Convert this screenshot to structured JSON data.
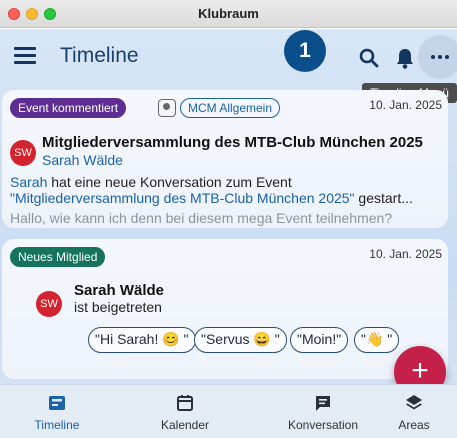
{
  "window": {
    "title": "Klubraum"
  },
  "header": {
    "title": "Timeline",
    "badge": "1",
    "tooltip": "Timeline-Menü"
  },
  "cards": [
    {
      "tag": "Event kommentiert",
      "group_chip": "MCM Allgemein",
      "date": "10. Jan. 2025",
      "avatar": "SW",
      "headline": "Mitgliederversammlung des MTB-Club München 2025",
      "author": "Sarah Wälde",
      "body_name": "Sarah",
      "body_middle": " hat eine neue Konversation zum Event ",
      "body_event": "\"Mitgliederversammlung des MTB-Club München 2025\"",
      "body_end": " gestart...",
      "preview": "Hallo, wie kann ich denn bei diesem mega Event teilnehmen?"
    },
    {
      "tag": "Neues Mitglied",
      "date": "10. Jan. 2025",
      "avatar": "SW",
      "headline": "Sarah Wälde",
      "sub": "ist beigetreten",
      "quick_replies": [
        "\"Hi Sarah! 😊 \"",
        "\"Servus 😄 \"",
        "\"Moin!\"",
        "\"👋 \""
      ]
    }
  ],
  "fab": {
    "label": "+"
  },
  "nav": {
    "items": [
      {
        "label": "Timeline",
        "icon": "timeline-icon",
        "active": true
      },
      {
        "label": "Kalender",
        "icon": "calendar-icon",
        "active": false
      },
      {
        "label": "Konversation",
        "icon": "conversation-icon",
        "active": false
      },
      {
        "label": "Areas",
        "icon": "layers-icon",
        "active": false
      }
    ]
  },
  "colors": {
    "accent": "#1b63a6",
    "event_tag": "#5e2d91",
    "member_tag": "#15745b",
    "fab": "#c4204a",
    "avatar": "#d3232f"
  }
}
